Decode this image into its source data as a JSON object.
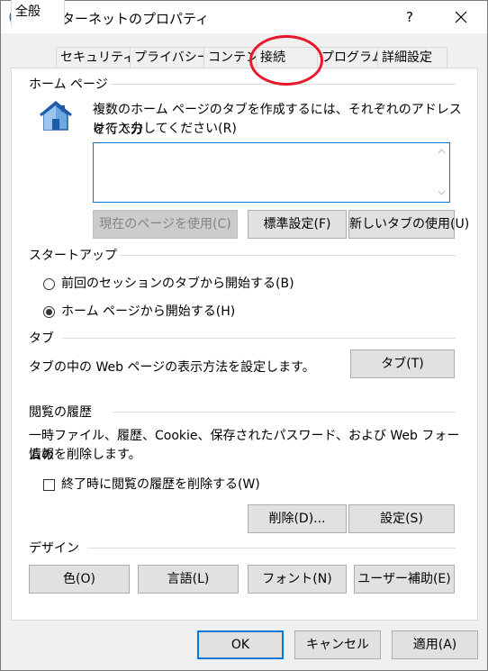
{
  "window": {
    "title": "インターネットのプロパティ",
    "help_label": "?"
  },
  "tabs": [
    {
      "label": "全般"
    },
    {
      "label": "セキュリティ"
    },
    {
      "label": "プライバシー"
    },
    {
      "label": "コンテンツ"
    },
    {
      "label": "接続"
    },
    {
      "label": "プログラム"
    },
    {
      "label": "詳細設定"
    }
  ],
  "homepage": {
    "group_label": "ホーム ページ",
    "description_line1": "複数のホーム ページのタブを作成するには、それぞれのアドレスを行で分",
    "description_line2": "けて入力してください(R)",
    "value": "",
    "use_current_label": "現在のページを使用(C)",
    "use_default_label": "標準設定(F)",
    "use_new_tab_label": "新しいタブの使用(U)"
  },
  "startup": {
    "group_label": "スタートアップ",
    "option_tabs_label": "前回のセッションのタブから開始する(B)",
    "option_home_label": "ホーム ページから開始する(H)",
    "selected": "home"
  },
  "tabs_section": {
    "group_label": "タブ",
    "description": "タブの中の Web ページの表示方法を設定します。",
    "button_label": "タブ(T)"
  },
  "history": {
    "group_label": "閲覧の履歴",
    "description_line1": "一時ファイル、履歴、Cookie、保存されたパスワード、および Web フォームの",
    "description_line2": "情報を削除します。",
    "delete_on_exit_label": "終了時に閲覧の履歴を削除する(W)",
    "delete_on_exit_checked": false,
    "delete_label": "削除(D)...",
    "settings_label": "設定(S)"
  },
  "design": {
    "group_label": "デザイン",
    "colors_label": "色(O)",
    "languages_label": "言語(L)",
    "fonts_label": "フォント(N)",
    "accessibility_label": "ユーザー補助(E)"
  },
  "footer": {
    "ok_label": "OK",
    "cancel_label": "キャンセル",
    "apply_label": "適用(A)"
  },
  "colors": {
    "focus_border": "#0078d7",
    "highlight_circle": "#e8182a"
  }
}
